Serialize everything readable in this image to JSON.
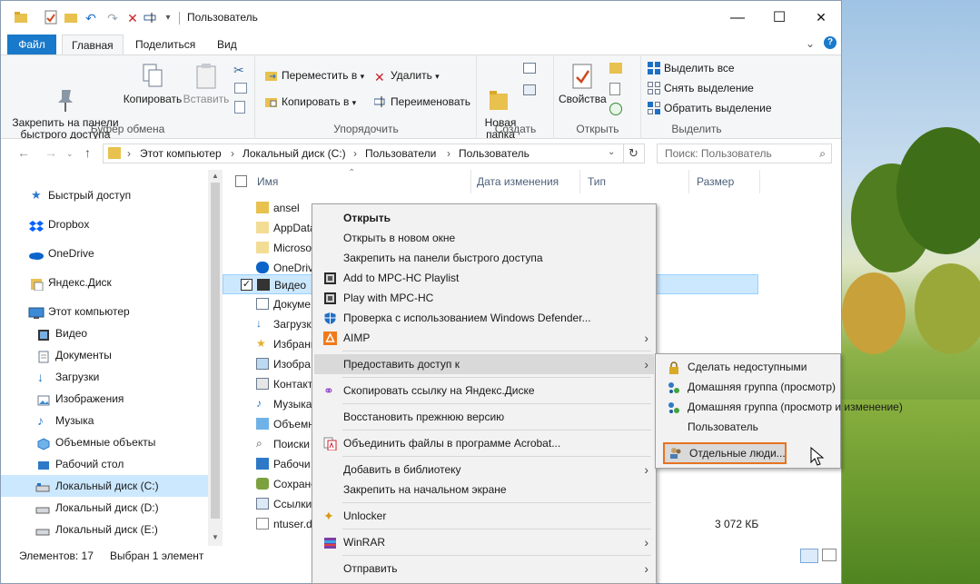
{
  "window": {
    "title": "Пользователь",
    "minimize_glyph": "—",
    "maximize_glyph": "☐",
    "close_glyph": "✕"
  },
  "ribbon_tabs": [
    {
      "label": "Файл"
    },
    {
      "label": "Главная"
    },
    {
      "label": "Поделиться"
    },
    {
      "label": "Вид"
    }
  ],
  "ribbon": {
    "clipboard": {
      "label": "Буфер обмена",
      "pin": "Закрепить на панели\nбыстрого доступа",
      "copy": "Копировать",
      "paste": "Вставить"
    },
    "organize": {
      "label": "Упорядочить",
      "move": "Переместить в",
      "copy_to": "Копировать в",
      "delete": "Удалить",
      "rename": "Переименовать"
    },
    "new": {
      "label": "Создать",
      "new_folder": "Новая\nпапка"
    },
    "open": {
      "label": "Открыть",
      "properties": "Свойства"
    },
    "select": {
      "label": "Выделить",
      "select_all": "Выделить все",
      "select_none": "Снять выделение",
      "invert": "Обратить выделение"
    }
  },
  "address": {
    "crumbs": [
      "Этот компьютер",
      "Локальный диск (C:)",
      "Пользователи",
      "Пользователь"
    ],
    "search_placeholder": "Поиск: Пользователь"
  },
  "nav": [
    {
      "label": "Быстрый доступ",
      "icon": "star-icon"
    },
    {
      "label": "Dropbox",
      "icon": "dropbox-icon"
    },
    {
      "label": "OneDrive",
      "icon": "cloud-icon"
    },
    {
      "label": "Яндекс.Диск",
      "icon": "yandex-disk-icon"
    },
    {
      "label": "Этот компьютер",
      "icon": "computer-icon"
    },
    {
      "label": "Видео",
      "icon": "video-icon"
    },
    {
      "label": "Документы",
      "icon": "documents-icon"
    },
    {
      "label": "Загрузки",
      "icon": "downloads-icon"
    },
    {
      "label": "Изображения",
      "icon": "images-icon"
    },
    {
      "label": "Музыка",
      "icon": "music-icon"
    },
    {
      "label": "Объемные объекты",
      "icon": "3d-objects-icon"
    },
    {
      "label": "Рабочий стол",
      "icon": "desktop-icon"
    },
    {
      "label": "Локальный диск (C:)",
      "icon": "drive-icon"
    },
    {
      "label": "Локальный диск (D:)",
      "icon": "drive-icon"
    },
    {
      "label": "Локальный диск (E:)",
      "icon": "drive-icon"
    }
  ],
  "columns": {
    "name": "Имя",
    "date": "Дата изменения",
    "type": "Тип",
    "size": "Размер"
  },
  "files": [
    {
      "name": "ansel",
      "date": "",
      "type": "",
      "size": ""
    },
    {
      "name": "AppData",
      "date": "",
      "type": "",
      "size": ""
    },
    {
      "name": "Microso",
      "date": "",
      "type": "",
      "size": ""
    },
    {
      "name": "OneDriv",
      "date": "",
      "type": "",
      "size": ""
    },
    {
      "name": "Видео",
      "date": "",
      "type": "",
      "size": ""
    },
    {
      "name": "Докуме",
      "date": "",
      "type": "",
      "size": ""
    },
    {
      "name": "Загрузк",
      "date": "",
      "type": "",
      "size": ""
    },
    {
      "name": "Избранн",
      "date": "",
      "type": "",
      "size": ""
    },
    {
      "name": "Изобра",
      "date": "",
      "type": "",
      "size": ""
    },
    {
      "name": "Контакт",
      "date": "",
      "type": "",
      "size": ""
    },
    {
      "name": "Музыка",
      "date": "",
      "type": "",
      "size": ""
    },
    {
      "name": "Объемн",
      "date": "",
      "type": "",
      "size": ""
    },
    {
      "name": "Поиски",
      "date": "",
      "type": "",
      "size": ""
    },
    {
      "name": "Рабочи",
      "date": "",
      "type": "",
      "size": ""
    },
    {
      "name": "Сохране",
      "date": "",
      "type": "",
      "size": ""
    },
    {
      "name": "Ссылки",
      "date": "",
      "type": "",
      "size": ""
    },
    {
      "name": "ntuser.d",
      "date": "",
      "type": "",
      "size": "3 072 КБ"
    }
  ],
  "status": {
    "count": "Элементов: 17",
    "selected": "Выбран 1 элемент"
  },
  "context_menu": [
    {
      "label": "Открыть",
      "bold": true
    },
    {
      "label": "Открыть в новом окне"
    },
    {
      "label": "Закрепить на панели быстрого доступа"
    },
    {
      "label": "Add to MPC-HC Playlist",
      "icon": "mpc-icon"
    },
    {
      "label": "Play with MPC-HC",
      "icon": "mpc-icon"
    },
    {
      "label": "Проверка с использованием Windows Defender...",
      "icon": "defender-icon"
    },
    {
      "label": "AIMP",
      "icon": "aimp-icon",
      "submenu": true
    },
    {
      "label": "Предоставить доступ к",
      "submenu": true,
      "highlight": true
    },
    {
      "label": "Скопировать ссылку на Яндекс.Диске",
      "icon": "link-icon"
    },
    {
      "label": "Восстановить прежнюю версию"
    },
    {
      "label": "Объединить файлы в программе Acrobat...",
      "icon": "acrobat-icon"
    },
    {
      "label": "Добавить в библиотеку",
      "submenu": true
    },
    {
      "label": "Закрепить на начальном экране"
    },
    {
      "label": "Unlocker",
      "icon": "unlocker-icon"
    },
    {
      "label": "WinRAR",
      "icon": "winrar-icon",
      "submenu": true
    },
    {
      "label": "Отправить",
      "submenu": true
    }
  ],
  "submenu": [
    {
      "label": "Сделать недоступными",
      "icon": "lock-icon"
    },
    {
      "label": "Домашняя группа (просмотр)",
      "icon": "homegroup-icon"
    },
    {
      "label": "Домашняя группа (просмотр и изменение)",
      "icon": "homegroup-icon"
    },
    {
      "label": "Пользователь"
    },
    {
      "label": "Отдельные люди...",
      "icon": "people-icon",
      "highlight": true
    }
  ],
  "colors": {
    "accent": "#1979ca",
    "selection": "#cce8ff",
    "menu_highlight": "#d9d9d9",
    "focus_outline": "#e8731f"
  }
}
